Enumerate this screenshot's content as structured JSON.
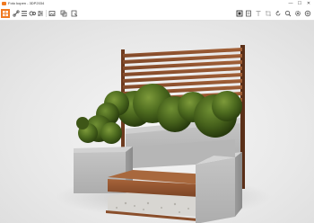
{
  "window": {
    "title": "Foto kopen - 3DP2034",
    "minimize_label": "—",
    "maximize_label": "☐",
    "close_label": "✕"
  },
  "toolbar": {
    "left_tools": [
      {
        "icon": "grid-icon",
        "active": true
      },
      {
        "icon": "link-icon"
      },
      {
        "icon": "list-icon"
      },
      {
        "icon": "measure-icon"
      },
      {
        "icon": "settings-sliders-icon"
      },
      {
        "icon": "image-icon"
      },
      {
        "icon": "layers-icon"
      },
      {
        "icon": "export-icon"
      }
    ],
    "right_tools": [
      {
        "icon": "frame-icon"
      },
      {
        "icon": "document-icon"
      },
      {
        "icon": "text-icon"
      },
      {
        "icon": "crop-icon"
      },
      {
        "icon": "rotate-icon"
      },
      {
        "icon": "zoom-icon"
      },
      {
        "icon": "gear-icon"
      },
      {
        "icon": "share-icon"
      }
    ]
  },
  "colors": {
    "accent": "#f07a22",
    "wood": "#8a4f2c",
    "concrete": "#b9b9b9",
    "foliage": "#4d6b1e"
  }
}
